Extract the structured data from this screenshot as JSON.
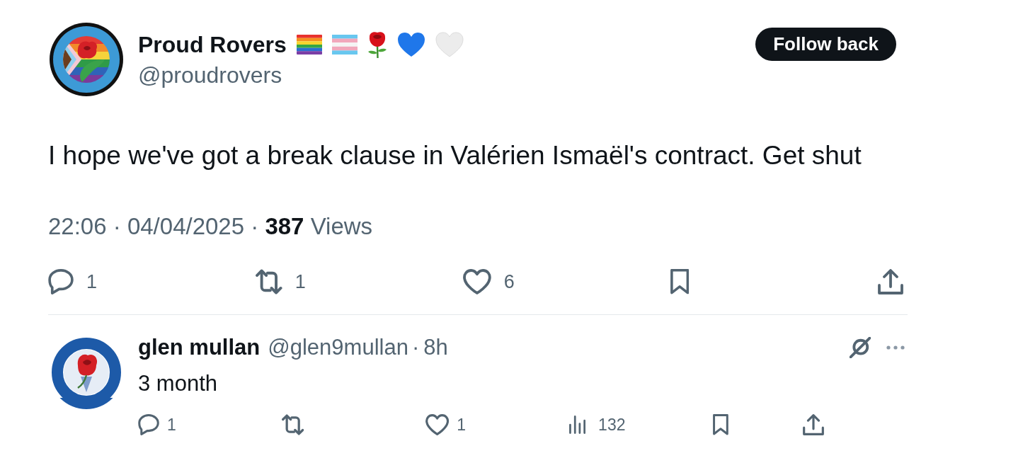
{
  "post": {
    "author": {
      "name": "Proud Rovers",
      "handle": "@proudrovers"
    },
    "follow_button": "Follow back",
    "text": "I hope we've got a break clause in Valérien Ismaël's contract. Get shut",
    "meta": "22:06 · 04/04/2025 · **387** Views",
    "actions": [
      {
        "kind": "reply",
        "count": "1"
      },
      {
        "kind": "repost",
        "count": "1"
      },
      {
        "kind": "like",
        "count": "6"
      },
      {
        "kind": "bookmark"
      },
      {
        "kind": "share"
      }
    ]
  },
  "replies": [
    {
      "author": {
        "name": "glen mullan",
        "handle": "@glen9mullan"
      },
      "separator": "·",
      "time": "8h",
      "text": "3 month",
      "actions": [
        {
          "kind": "reply",
          "count": "1"
        },
        {
          "kind": "repost"
        },
        {
          "kind": "like",
          "count": "1"
        },
        {
          "kind": "views",
          "count": "132"
        },
        {
          "kind": "bookmark"
        },
        {
          "kind": "share"
        }
      ]
    }
  ]
}
